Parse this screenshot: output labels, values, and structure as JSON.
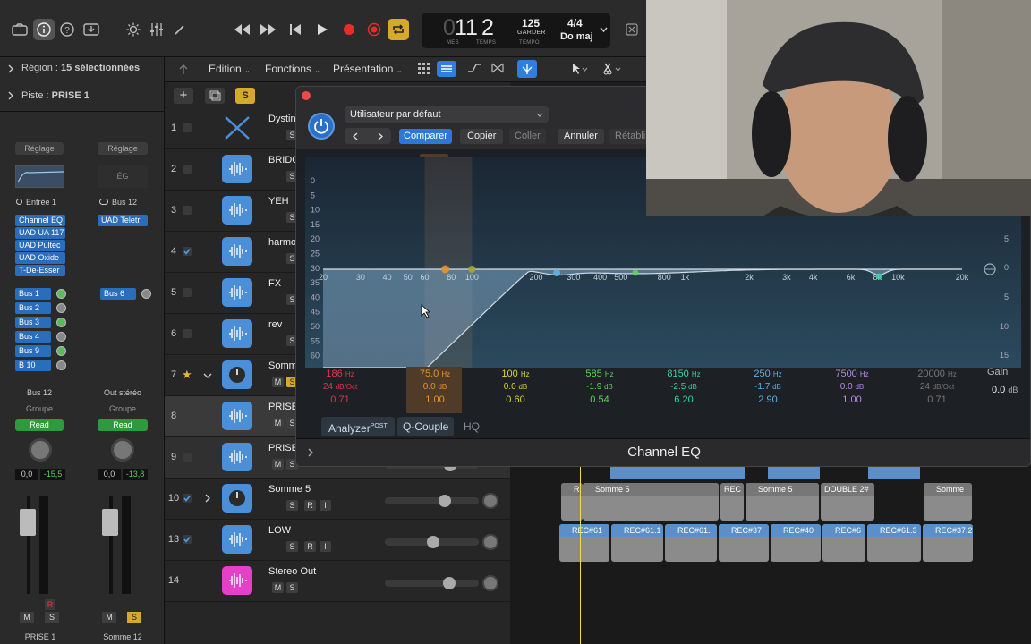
{
  "transport": {
    "bar": "11",
    "beat": "2",
    "bar_label": "MES",
    "beat_label": "TEMPS",
    "tempo": "125",
    "tempo_mode": "GARDER",
    "tempo_label": "TEMPO",
    "signature": "4/4",
    "key": "Do maj"
  },
  "inspector": {
    "region_label": "Région :",
    "region_value": "15 sélectionnées",
    "track_label": "Piste :",
    "track_value": "PRISE 1",
    "strip1": {
      "setting": "Réglage",
      "input": "Entrée 1",
      "plugins": [
        "Channel EQ",
        "UAD UA 117",
        "UAD Pultec",
        "UAD Oxide",
        "T-De-Esser"
      ],
      "sends": [
        "Bus 1",
        "Bus 2",
        "Bus 3",
        "Bus 4",
        "Bus 9",
        "B 10"
      ],
      "output": "Bus 12",
      "group": "Groupe",
      "automation": "Read",
      "vol": "0,0",
      "peak": "-15,5",
      "name": "PRISE 1"
    },
    "strip2": {
      "setting": "Réglage",
      "eq": "ÉG",
      "input": "Bus 12",
      "plugins": [
        "UAD Teletr"
      ],
      "sends": [
        "Bus 6"
      ],
      "output": "Out stéréo",
      "group": "Groupe",
      "automation": "Read",
      "vol": "0,0",
      "peak": "-13,8",
      "name": "Somme 12"
    }
  },
  "menubar": {
    "edit": "Edition",
    "functions": "Fonctions",
    "presentation": "Présentation"
  },
  "tracks": [
    {
      "num": "1",
      "name": "Dystin"
    },
    {
      "num": "2",
      "name": "BRIDG"
    },
    {
      "num": "3",
      "name": "YEH"
    },
    {
      "num": "4",
      "name": "harmo"
    },
    {
      "num": "5",
      "name": "FX"
    },
    {
      "num": "6",
      "name": "rev"
    },
    {
      "num": "7",
      "name": "Somm"
    },
    {
      "num": "8",
      "name": "PRISE"
    },
    {
      "num": "9",
      "name": "PRISE"
    },
    {
      "num": "10",
      "name": "Somme 5"
    },
    {
      "num": "13",
      "name": "LOW"
    },
    {
      "num": "14",
      "name": "Stereo Out"
    }
  ],
  "track_buttons": {
    "m": "M",
    "s": "S",
    "r": "R",
    "i": "I"
  },
  "regions_row1": [
    "R",
    "Somme 5",
    "REC",
    "Somme 5",
    "DOUBLE 2#",
    "Somme"
  ],
  "regions_row2": [
    "REC#61",
    "REC#61.1",
    "REC#61.",
    "REC#37",
    "REC#40",
    "REC#6",
    "REC#61.3",
    "REC#37.2"
  ],
  "eq": {
    "preset": "Utilisateur par défaut",
    "compare": "Comparer",
    "copy": "Copier",
    "paste": "Coller",
    "undo": "Annuler",
    "redo": "Rétabli",
    "db_scale_left": [
      "0",
      "5",
      "10",
      "15",
      "20",
      "25",
      "30",
      "35",
      "40",
      "45",
      "50",
      "55",
      "60"
    ],
    "db_scale_right": [
      "5",
      "0",
      "5",
      "10",
      "15"
    ],
    "freq_labels": [
      "20",
      "30",
      "40",
      "50",
      "60",
      "80",
      "100",
      "200",
      "300",
      "400",
      "500",
      "800",
      "1k",
      "2k",
      "3k",
      "4k",
      "6k",
      "8k",
      "10k",
      "20k"
    ],
    "bands": [
      {
        "freq": "186",
        "unit": "Hz",
        "gain": "24",
        "gain_unit": "dB/Oct",
        "q": "0.71",
        "color": "#e0364d"
      },
      {
        "freq": "75.0",
        "unit": "Hz",
        "gain": "0.0",
        "gain_unit": "dB",
        "q": "1.00",
        "color": "#e8922e"
      },
      {
        "freq": "100",
        "unit": "Hz",
        "gain": "0.0",
        "gain_unit": "dB",
        "q": "0.60",
        "color": "#d9d531"
      },
      {
        "freq": "585",
        "unit": "Hz",
        "gain": "-1.9",
        "gain_unit": "dB",
        "q": "0.54",
        "color": "#5fd45a"
      },
      {
        "freq": "8150",
        "unit": "Hz",
        "gain": "-2.5",
        "gain_unit": "dB",
        "q": "6.20",
        "color": "#37d3a3"
      },
      {
        "freq": "250",
        "unit": "Hz",
        "gain": "-1.7",
        "gain_unit": "dB",
        "q": "2.90",
        "color": "#5fb4e6"
      },
      {
        "freq": "7500",
        "unit": "Hz",
        "gain": "0.0",
        "gain_unit": "dB",
        "q": "1.00",
        "color": "#b889e0"
      },
      {
        "freq": "20000",
        "unit": "Hz",
        "gain": "24",
        "gain_unit": "dB/Oct",
        "q": "0.71",
        "color": "#777777"
      }
    ],
    "gain_label": "Gain",
    "gain_value": "0.0",
    "gain_unit": "dB",
    "analyzer": "Analyzer",
    "analyzer_sup": "POST",
    "qcouple": "Q-Couple",
    "hq": "HQ",
    "title": "Channel EQ"
  }
}
